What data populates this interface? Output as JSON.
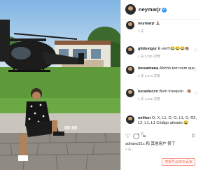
{
  "post": {
    "author": "neymarjr",
    "caption_time": "1 天"
  },
  "comments": [
    {
      "user": "neymarjr",
      "text": "🙏🏽",
      "meta": "1 天"
    },
    {
      "user": "gildovigor",
      "text": "É ele!!!😂😂😂👏🏽",
      "meta": "1 天   3,701 次赞"
    },
    {
      "user": "leosantana",
      "text": "Ahhhh tem nem que",
      "meta": "1 天   1,274 次赞"
    },
    {
      "user": "lucaslucco",
      "text": "Bem tranquilo ..👏🏽",
      "meta": "1 天   1,341 次赞"
    },
    {
      "user": "neilton",
      "text": "O, X, L1, O, O, L1, O, R2, L2, L1, L1 Código ativado 😂",
      "meta": "1 天"
    }
  ],
  "actions": {
    "like_icon": "heart-icon",
    "comment_icon": "comment-icon",
    "share_icon": "share-icon",
    "save_icon": "bookmark-icon"
  },
  "likes_line": "adriano21c 和 其他用户 赞了",
  "time_ago": "1 天",
  "watermark": "搜狐号@体坛百家"
}
